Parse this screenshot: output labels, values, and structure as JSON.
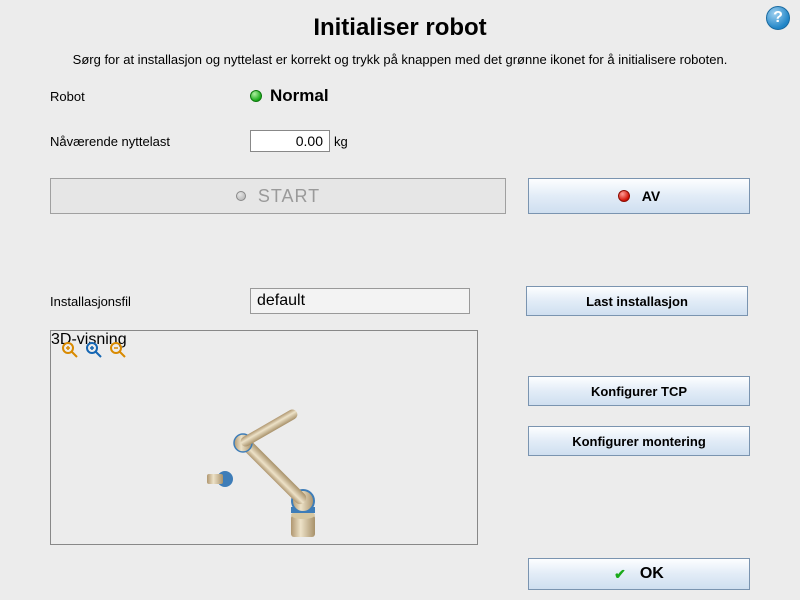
{
  "title": "Initialiser robot",
  "subtitle": "Sørg for at installasjon og nyttelast er korrekt og trykk på knappen med det grønne ikonet for å initialisere roboten.",
  "robot": {
    "label": "Robot",
    "status": "Normal"
  },
  "payload": {
    "label": "Nåværende nyttelast",
    "value": "0.00",
    "unit": "kg"
  },
  "buttons": {
    "start": "START",
    "off": "AV",
    "load_installation": "Last installasjon",
    "config_tcp": "Konfigurer TCP",
    "config_mounting": "Konfigurer montering",
    "ok": "OK"
  },
  "installation": {
    "label": "Installasjonsfil",
    "file": "default"
  },
  "view3d": {
    "label": "3D-visning"
  },
  "icons": {
    "help": "?",
    "check": "✔"
  }
}
